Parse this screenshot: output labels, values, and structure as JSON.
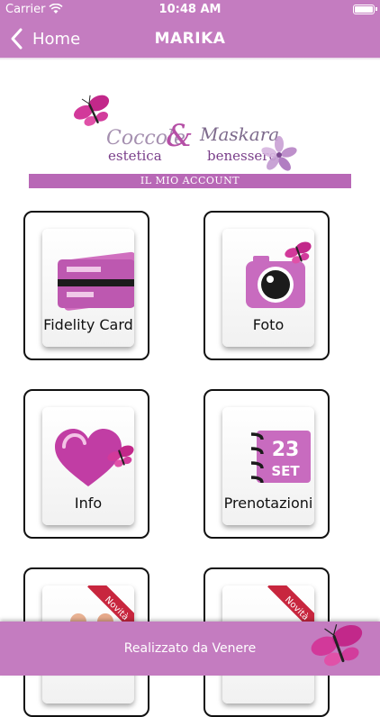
{
  "status_bar": {
    "carrier": "Carrier",
    "time": "10:48 AM"
  },
  "nav": {
    "back_label": "Home",
    "title": "MARIKA"
  },
  "logo": {
    "line1a": "Coccole",
    "ampersand": "&",
    "line1b": "Maskara",
    "line2a": "estetica",
    "line2b": "benessere",
    "banner": "IL MIO ACCOUNT"
  },
  "tiles": [
    {
      "label": "Fidelity Card",
      "icon": "credit-card-icon"
    },
    {
      "label": "Foto",
      "icon": "camera-icon"
    },
    {
      "label": "Info",
      "icon": "heart-icon"
    },
    {
      "label": "Prenotazioni",
      "icon": "calendar-icon",
      "day": "23",
      "month": "SET"
    },
    {
      "ribbon": "Novità"
    },
    {
      "ribbon": "Novità"
    }
  ],
  "footer": {
    "text": "Realizzato da Venere"
  },
  "colors": {
    "brand": "#c47cc0",
    "accent": "#b868b6"
  }
}
